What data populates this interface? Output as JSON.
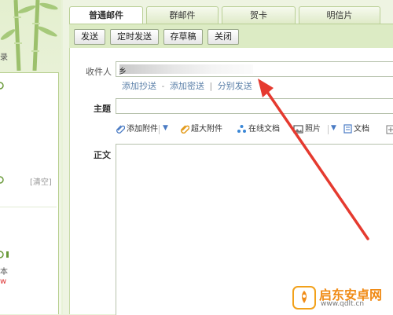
{
  "tabs": [
    {
      "label": "普通邮件",
      "active": true
    },
    {
      "label": "群邮件",
      "active": false
    },
    {
      "label": "贺卡",
      "active": false
    },
    {
      "label": "明信片",
      "active": false
    }
  ],
  "toolbar": {
    "send": "发送",
    "scheduled_send": "定时发送",
    "save_draft": "存草稿",
    "close": "关闭"
  },
  "form": {
    "recipient_label": "收件人",
    "recipient_value": "乡",
    "add_cc": "添加抄送",
    "link_sep_1": "-",
    "add_bcc": "添加密送",
    "link_sep_2": "|",
    "send_separately": "分别发送",
    "subject_label": "主题",
    "body_label": "正文"
  },
  "attachments": {
    "add_attachment": "添加附件",
    "large_attachment": "超大附件",
    "online_doc": "在线文档",
    "photo": "照片",
    "document": "文档"
  },
  "sidebar": {
    "fragment_1": "录",
    "fragment_2": "[清空]",
    "fragment_3": "本",
    "fragment_4": "w"
  },
  "watermark": {
    "name": "启东安卓网",
    "url": "www.qdlt.cn"
  },
  "colors": {
    "accent_green": "#b9cf95",
    "link_blue": "#5a7fa8",
    "arrow_red": "#e53a2f"
  }
}
